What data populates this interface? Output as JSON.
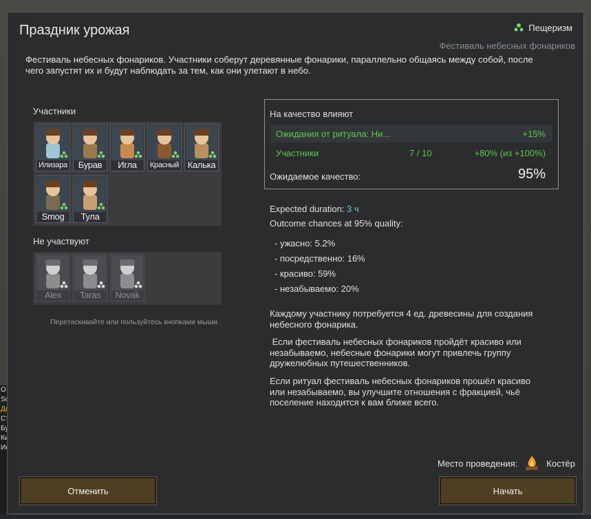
{
  "dialog": {
    "title": "Праздник урожая",
    "ideology": {
      "label": "Пещеризм",
      "icon": "ideology-icon"
    },
    "ritual_name": "Фестиваль небесных фонариков",
    "description": "Фестиваль небесных фонариков. Участники соберут деревянные фонарики, параллельно общаясь между собой, после чего запустят их и будут наблюдать за тем, как они улетают в небо."
  },
  "participants": {
    "label": "Участники",
    "pawns": [
      {
        "name": "Илизара",
        "role": "participant"
      },
      {
        "name": "Бурав",
        "role": "participant"
      },
      {
        "name": "Игла",
        "role": "participant"
      },
      {
        "name": "Красный",
        "role": "participant"
      },
      {
        "name": "Калька",
        "role": "participant"
      },
      {
        "name": "Smog",
        "role": "participant"
      },
      {
        "name": "Тула",
        "role": "participant"
      }
    ]
  },
  "non_participants": {
    "label": "Не участвуют",
    "pawns": [
      {
        "name": "Alex",
        "state": "sleeping"
      },
      {
        "name": "Taras",
        "state": "animal"
      },
      {
        "name": "Novak",
        "state": "downed"
      }
    ]
  },
  "hint": "Перетаскивайте или пользуйтесь кнопками мыши.",
  "quality": {
    "header": "На качество влияют",
    "rows": [
      {
        "label": "Ожидания от ритуала: Ни...",
        "middle": "",
        "value": "+15%"
      },
      {
        "label": "Участники",
        "middle": "7 / 10",
        "value": "+80% (из +100%)"
      }
    ],
    "expected_label": "Ожидаемое качество:",
    "expected_value": "95%"
  },
  "duration": {
    "label": "Expected duration:",
    "value": "3 ч"
  },
  "outcome": {
    "label": "Outcome chances at 95% quality:",
    "items": [
      "- ужасно: 5.2%",
      "- посредственно: 16%",
      "- красиво: 59%",
      "- незабываемо: 20%"
    ]
  },
  "notes": [
    "Каждому участнику потребуется 4 ед. древесины для создания небесного фонарика.",
    " Если фестиваль небесных фонариков пройдёт красиво или незабываемо, небесные фонарики могут привлечь группу дружелюбных путешественников.",
    "Если ритуал фестиваль небесных фонариков прошёл красиво или незабываемо, вы улучшите отношения с фракцией, чьё поселение находится к вам ближе всего."
  ],
  "venue": {
    "label": "Место проведения:",
    "value": "Костёр",
    "icon": "campfire-icon"
  },
  "buttons": {
    "cancel": "Отменить",
    "start": "Начать"
  },
  "background": {
    "side_letters": [
      "О",
      "Sc",
      "Да",
      "Ст",
      "Бу",
      "Ки",
      "Ис"
    ]
  },
  "colors": {
    "accent_green": "#5ec74a",
    "duration_cyan": "#5fd3d8",
    "button": "#4e3f22"
  }
}
